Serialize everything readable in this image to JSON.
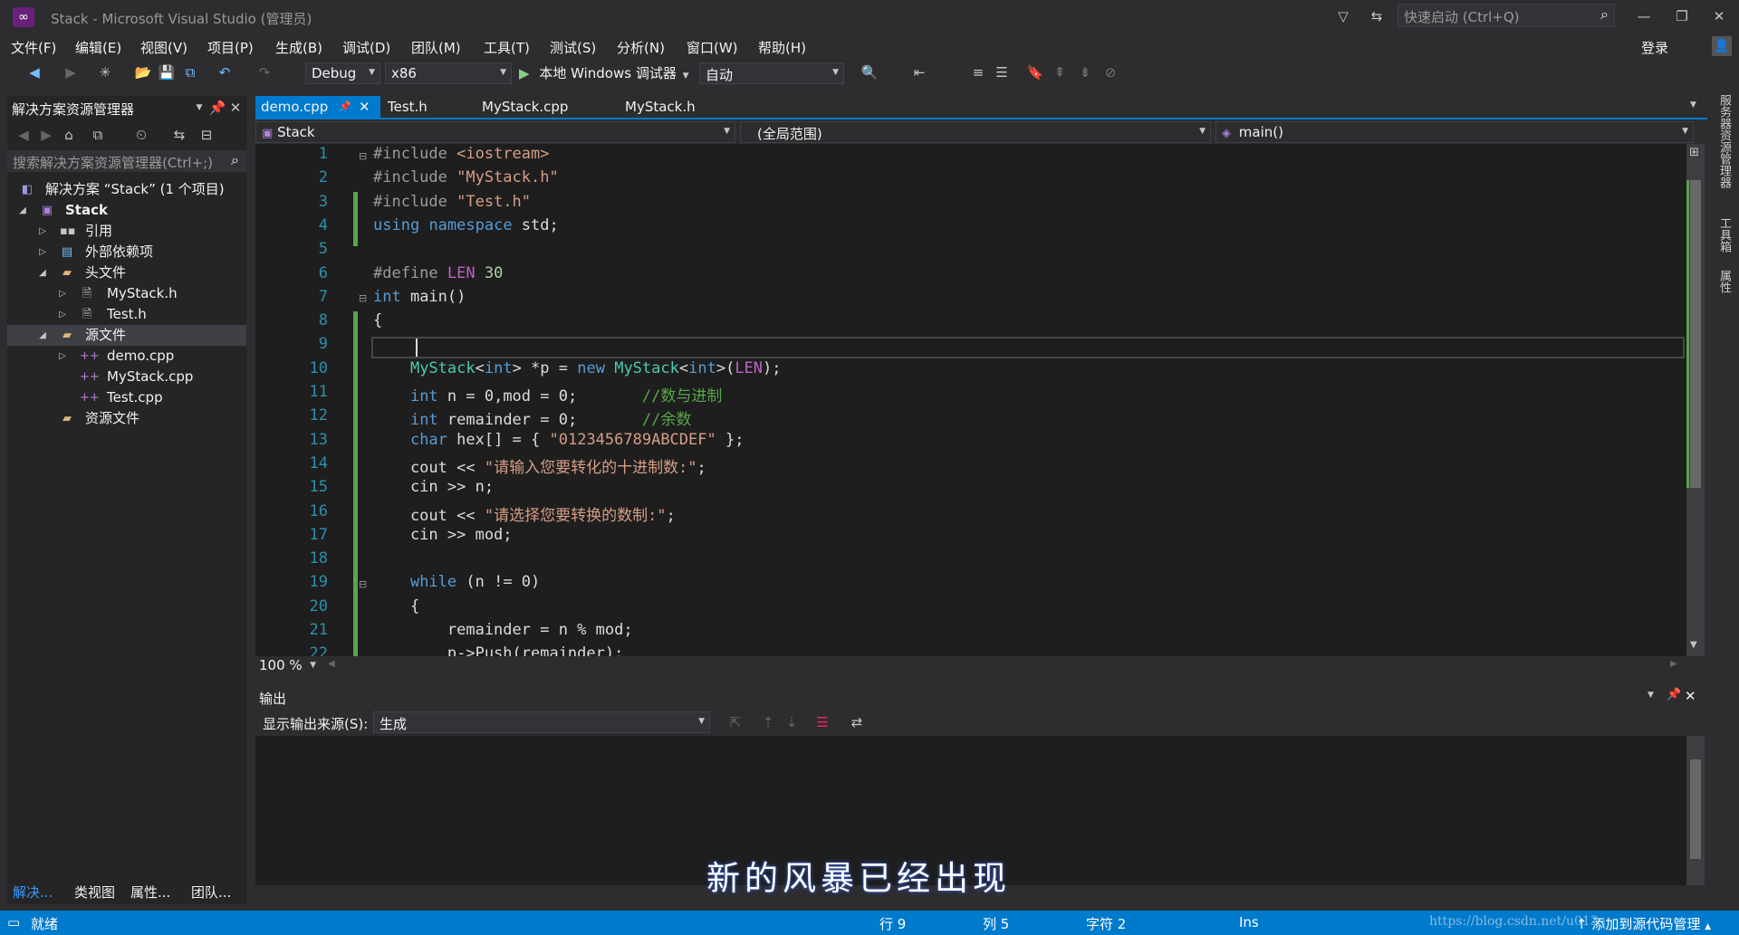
{
  "titlebar": {
    "title": "Stack - Microsoft Visual Studio (管理员)",
    "quick_launch_placeholder": "快速启动 (Ctrl+Q)",
    "sign_in": "登录"
  },
  "menu": [
    "文件(F)",
    "编辑(E)",
    "视图(V)",
    "项目(P)",
    "生成(B)",
    "调试(D)",
    "团队(M)",
    "工具(T)",
    "测试(S)",
    "分析(N)",
    "窗口(W)",
    "帮助(H)"
  ],
  "toolbar": {
    "config": "Debug",
    "platform": "x86",
    "run_label": "本地 Windows 调试器",
    "run_mode": "自动"
  },
  "solution_explorer": {
    "title": "解决方案资源管理器",
    "search_placeholder": "搜索解决方案资源管理器(Ctrl+;)",
    "items": [
      {
        "label": "解决方案 “Stack” (1 个项目)",
        "icon": "solution-icon"
      },
      {
        "label": "Stack",
        "icon": "project-icon"
      },
      {
        "label": "引用",
        "icon": "references-icon"
      },
      {
        "label": "外部依赖项",
        "icon": "folder-icon"
      },
      {
        "label": "头文件",
        "icon": "folder-icon"
      },
      {
        "label": "MyStack.h",
        "icon": "header-file-icon"
      },
      {
        "label": "Test.h",
        "icon": "header-file-icon"
      },
      {
        "label": "源文件",
        "icon": "folder-icon"
      },
      {
        "label": "demo.cpp",
        "icon": "cpp-file-icon"
      },
      {
        "label": "MyStack.cpp",
        "icon": "cpp-file-icon"
      },
      {
        "label": "Test.cpp",
        "icon": "cpp-file-icon"
      },
      {
        "label": "资源文件",
        "icon": "folder-icon"
      }
    ],
    "bottom_tabs": [
      "解决...",
      "类视图",
      "属性...",
      "团队..."
    ]
  },
  "editor": {
    "tabs": [
      "demo.cpp",
      "Test.h",
      "MyStack.cpp",
      "MyStack.h"
    ],
    "active_tab": "demo.cpp",
    "nav_project": "Stack",
    "nav_scope": "(全局范围)",
    "nav_member": "main()",
    "zoom": "100 %",
    "lines": [
      {
        "n": "1",
        "parts": [
          [
            "pp",
            "#include "
          ],
          [
            "str",
            "<iostream>"
          ]
        ]
      },
      {
        "n": "2",
        "parts": [
          [
            "pp",
            "#include "
          ],
          [
            "str",
            "\"MyStack.h\""
          ]
        ]
      },
      {
        "n": "3",
        "parts": [
          [
            "pp",
            "#include "
          ],
          [
            "str",
            "\"Test.h\""
          ]
        ]
      },
      {
        "n": "4",
        "parts": [
          [
            "kw",
            "using"
          ],
          [
            "",
            " "
          ],
          [
            "kw",
            "namespace"
          ],
          [
            "",
            " std;"
          ]
        ]
      },
      {
        "n": "5",
        "parts": []
      },
      {
        "n": "6",
        "parts": [
          [
            "pp",
            "#define "
          ],
          [
            "mac",
            "LEN"
          ],
          [
            "",
            " "
          ],
          [
            "num",
            "30"
          ]
        ]
      },
      {
        "n": "7",
        "parts": [
          [
            "kw",
            "int"
          ],
          [
            "",
            " main()"
          ]
        ]
      },
      {
        "n": "8",
        "parts": [
          [
            "",
            "{"
          ]
        ]
      },
      {
        "n": "9",
        "parts": []
      },
      {
        "n": "10",
        "parts": [
          [
            "",
            "    "
          ],
          [
            "ty",
            "MyStack"
          ],
          [
            "",
            "<"
          ],
          [
            "kw",
            "int"
          ],
          [
            "",
            "> *p = "
          ],
          [
            "kw",
            "new"
          ],
          [
            "",
            " "
          ],
          [
            "ty",
            "MyStack"
          ],
          [
            "",
            "<"
          ],
          [
            "kw",
            "int"
          ],
          [
            "",
            ">("
          ],
          [
            "mac",
            "LEN"
          ],
          [
            "",
            ");"
          ]
        ]
      },
      {
        "n": "11",
        "parts": [
          [
            "",
            "    "
          ],
          [
            "kw",
            "int"
          ],
          [
            "",
            " n = 0,mod = 0;       "
          ],
          [
            "cm",
            "//数与进制"
          ]
        ]
      },
      {
        "n": "12",
        "parts": [
          [
            "",
            "    "
          ],
          [
            "kw",
            "int"
          ],
          [
            "",
            " remainder = 0;       "
          ],
          [
            "cm",
            "//余数"
          ]
        ]
      },
      {
        "n": "13",
        "parts": [
          [
            "",
            "    "
          ],
          [
            "kw",
            "char"
          ],
          [
            "",
            " hex[] = { "
          ],
          [
            "str",
            "\"0123456789ABCDEF\""
          ],
          [
            "",
            " };"
          ]
        ]
      },
      {
        "n": "14",
        "parts": [
          [
            "",
            "    cout << "
          ],
          [
            "str",
            "\"请输入您要转化的十进制数:\""
          ],
          [
            "",
            ";"
          ]
        ]
      },
      {
        "n": "15",
        "parts": [
          [
            "",
            "    cin >> n;"
          ]
        ]
      },
      {
        "n": "16",
        "parts": [
          [
            "",
            "    cout << "
          ],
          [
            "str",
            "\"请选择您要转换的数制:\""
          ],
          [
            "",
            ";"
          ]
        ]
      },
      {
        "n": "17",
        "parts": [
          [
            "",
            "    cin >> mod;"
          ]
        ]
      },
      {
        "n": "18",
        "parts": []
      },
      {
        "n": "19",
        "parts": [
          [
            "",
            "    "
          ],
          [
            "kw",
            "while"
          ],
          [
            "",
            " (n != 0)"
          ]
        ]
      },
      {
        "n": "20",
        "parts": [
          [
            "",
            "    {"
          ]
        ]
      },
      {
        "n": "21",
        "parts": [
          [
            "",
            "        remainder = n % mod;"
          ]
        ]
      },
      {
        "n": "22",
        "parts": [
          [
            "",
            "        p->Push(remainder);"
          ]
        ]
      }
    ]
  },
  "output": {
    "title": "输出",
    "source_label": "显示输出来源(S):",
    "source_value": "生成"
  },
  "subtitle": "新的风暴已经出现",
  "statusbar": {
    "ready": "就绪",
    "line": "行 9",
    "col": "列 5",
    "char": "字符 2",
    "mode": "Ins",
    "watermark": "https://blog.csdn.net/u013",
    "source_control": "添加到源代码管理"
  },
  "right_strip": [
    "服务器资源管理器",
    "工具箱",
    "属性"
  ]
}
